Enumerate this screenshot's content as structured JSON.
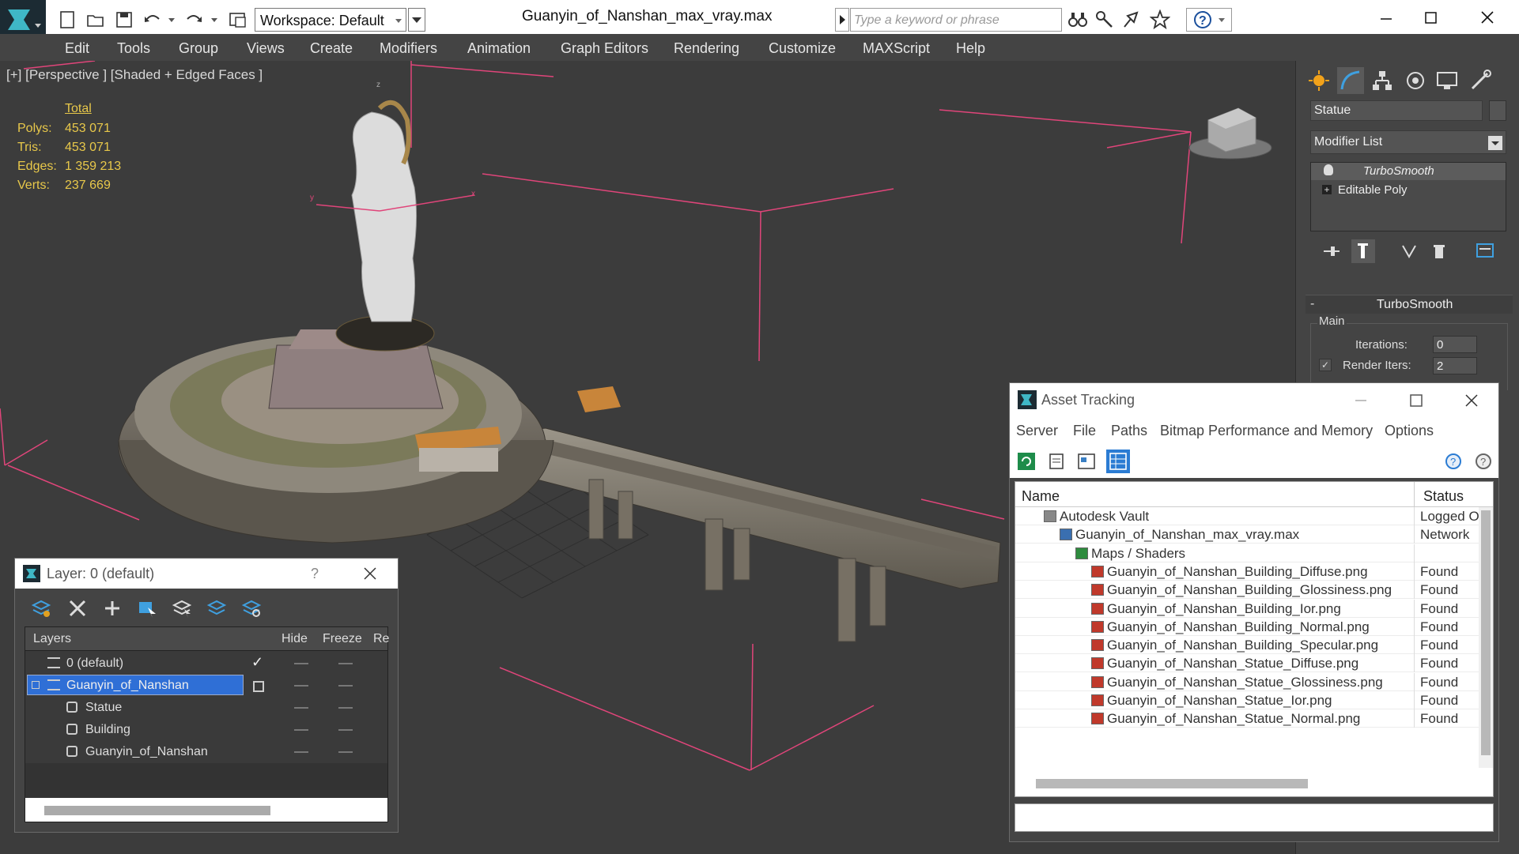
{
  "app": {
    "window_title": "Guanyin_of_Nanshan_max_vray.max",
    "workspace": "Workspace: Default",
    "search_placeholder": "Type a keyword or phrase"
  },
  "menu": [
    "Edit",
    "Tools",
    "Group",
    "Views",
    "Create",
    "Modifiers",
    "Animation",
    "Graph Editors",
    "Rendering",
    "Customize",
    "MAXScript",
    "Help"
  ],
  "viewport": {
    "label": "[+] [Perspective ] [Shaded + Edged Faces ]",
    "stats": {
      "header": "Total",
      "rows": [
        {
          "label": "Polys:",
          "value": "453 071"
        },
        {
          "label": "Tris:",
          "value": "453 071"
        },
        {
          "label": "Edges:",
          "value": "1 359 213"
        },
        {
          "label": "Verts:",
          "value": "237 669"
        }
      ]
    }
  },
  "command_panel": {
    "object_name": "Statue",
    "modifier_list": "Modifier List",
    "stack": [
      "TurboSmooth",
      "Editable Poly"
    ],
    "rollout_title": "TurboSmooth",
    "group_main": "Main",
    "iterations_label": "Iterations:",
    "iterations_value": "0",
    "render_iters_label": "Render Iters:",
    "render_iters_value": "2",
    "rollout_collapse": "-"
  },
  "layer_window": {
    "title": "Layer: 0 (default)",
    "help": "?",
    "columns": [
      "Layers",
      "Hide",
      "Freeze",
      "Re"
    ],
    "rows": [
      {
        "name": "0 (default)",
        "level": 0
      },
      {
        "name": "Guanyin_of_Nanshan",
        "level": 0
      },
      {
        "name": "Statue",
        "level": 1
      },
      {
        "name": "Building",
        "level": 1
      },
      {
        "name": "Guanyin_of_Nanshan",
        "level": 1
      }
    ]
  },
  "asset_window": {
    "title": "Asset Tracking",
    "menu": [
      "Server",
      "File",
      "Paths",
      "Bitmap Performance and Memory",
      "Options"
    ],
    "col_name": "Name",
    "col_status": "Status",
    "rows": [
      {
        "name": "Autodesk Vault",
        "status": "Logged O",
        "indent": 0
      },
      {
        "name": "Guanyin_of_Nanshan_max_vray.max",
        "status": "Network",
        "indent": 1
      },
      {
        "name": "Maps / Shaders",
        "status": "",
        "indent": 2
      },
      {
        "name": "Guanyin_of_Nanshan_Building_Diffuse.png",
        "status": "Found",
        "indent": 3
      },
      {
        "name": "Guanyin_of_Nanshan_Building_Glossiness.png",
        "status": "Found",
        "indent": 3
      },
      {
        "name": "Guanyin_of_Nanshan_Building_Ior.png",
        "status": "Found",
        "indent": 3
      },
      {
        "name": "Guanyin_of_Nanshan_Building_Normal.png",
        "status": "Found",
        "indent": 3
      },
      {
        "name": "Guanyin_of_Nanshan_Building_Specular.png",
        "status": "Found",
        "indent": 3
      },
      {
        "name": "Guanyin_of_Nanshan_Statue_Diffuse.png",
        "status": "Found",
        "indent": 3
      },
      {
        "name": "Guanyin_of_Nanshan_Statue_Glossiness.png",
        "status": "Found",
        "indent": 3
      },
      {
        "name": "Guanyin_of_Nanshan_Statue_Ior.png",
        "status": "Found",
        "indent": 3
      },
      {
        "name": "Guanyin_of_Nanshan_Statue_Normal.png",
        "status": "Found",
        "indent": 3
      }
    ]
  },
  "colors": {
    "accent": "#2b7cd3",
    "selection": "#2f6fd6",
    "stats": "#e8c84a",
    "gizmo": "#e0457a"
  }
}
